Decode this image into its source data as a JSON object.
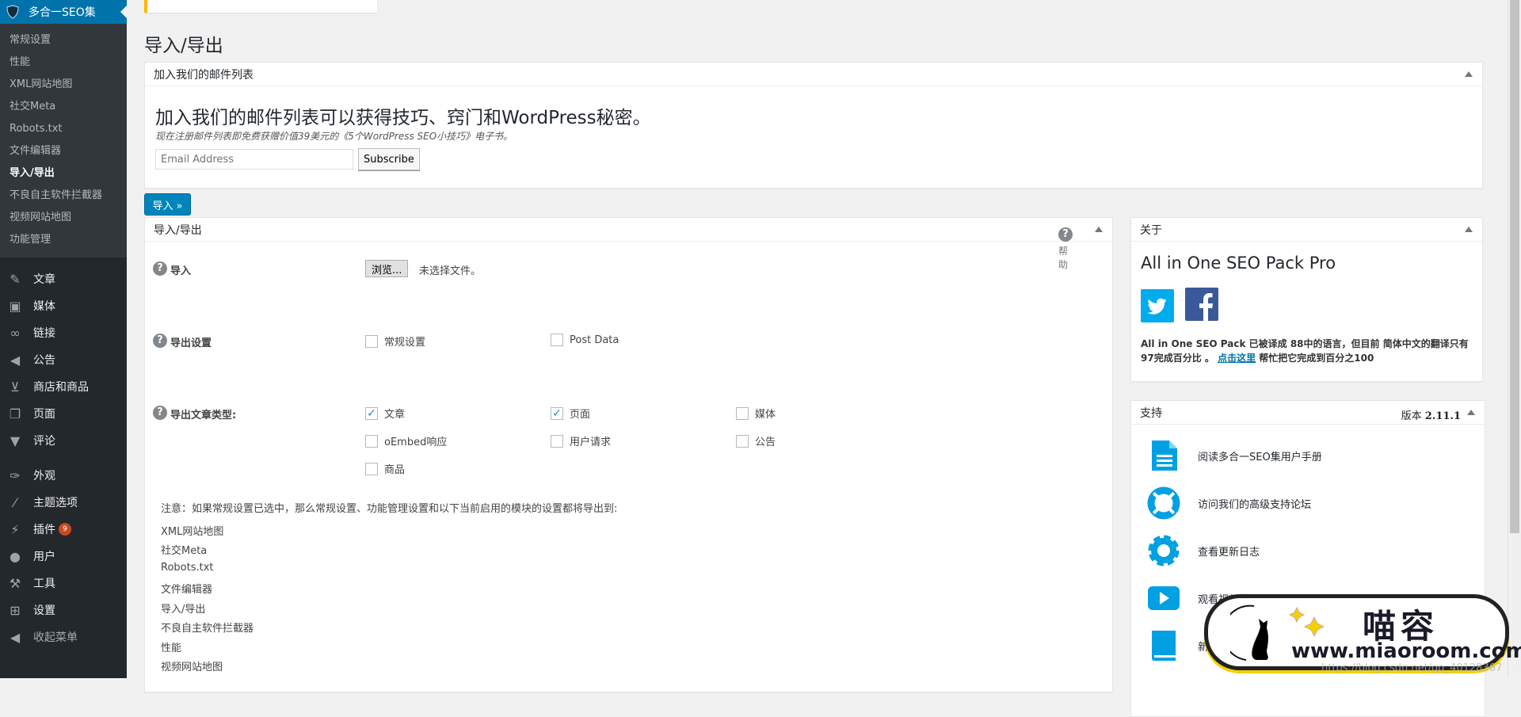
{
  "sidebar": {
    "plugin_title": "多合一SEO集",
    "submenu": [
      "常规设置",
      "性能",
      "XML网站地图",
      "社交Meta",
      "Robots.txt",
      "文件编辑器",
      "导入/导出",
      "不良自主软件拦截器",
      "视频网站地图",
      "功能管理"
    ],
    "current": "导入/导出",
    "menu": [
      {
        "label": "文章",
        "icon": "pin-icon"
      },
      {
        "label": "媒体",
        "icon": "media-icon"
      },
      {
        "label": "链接",
        "icon": "link-icon"
      },
      {
        "label": "公告",
        "icon": "megaphone-icon"
      },
      {
        "label": "商店和商品",
        "icon": "cart-icon"
      },
      {
        "label": "页面",
        "icon": "pages-icon"
      },
      {
        "label": "评论",
        "icon": "comment-icon"
      },
      {
        "label": "外观",
        "icon": "brush-icon"
      },
      {
        "label": "主题选项",
        "icon": "paintbrush-icon"
      },
      {
        "label": "插件",
        "icon": "plugin-icon",
        "badge": "9"
      },
      {
        "label": "用户",
        "icon": "user-icon"
      },
      {
        "label": "工具",
        "icon": "wrench-icon"
      },
      {
        "label": "设置",
        "icon": "settings-icon"
      }
    ],
    "collapse": "收起菜单"
  },
  "page_title": "导入/导出",
  "mailing": {
    "header": "加入我们的邮件列表",
    "headline": "加入我们的邮件列表可以获得技巧、窍门和WordPress秘密。",
    "subline": "现在注册邮件列表即免费获赠价值39美元的《5个WordPress SEO小技巧》电子书。",
    "email_placeholder": "Email Address",
    "subscribe": "Subscribe"
  },
  "import_button": "导入 »",
  "import_export": {
    "header": "导入/导出",
    "help": "帮助",
    "import_label": "导入",
    "browse": "浏览...",
    "no_file": "未选择文件。",
    "export_settings_label": "导出设置",
    "export_settings": [
      {
        "label": "常规设置",
        "checked": false
      },
      {
        "label": "Post Data",
        "checked": false
      }
    ],
    "export_types_label": "导出文章类型:",
    "export_types": [
      {
        "label": "文章",
        "checked": true
      },
      {
        "label": "页面",
        "checked": true
      },
      {
        "label": "媒体",
        "checked": false
      },
      {
        "label": "oEmbed响应",
        "checked": false
      },
      {
        "label": "用户请求",
        "checked": false
      },
      {
        "label": "公告",
        "checked": false
      },
      {
        "label": "商品",
        "checked": false
      }
    ],
    "note": "注意：如果常规设置已选中，那么常规设置、功能管理设置和以下当前启用的模块的设置都将导出到:",
    "modules": [
      "XML网站地图",
      "社交Meta",
      "Robots.txt",
      "文件编辑器",
      "导入/导出",
      "不良自主软件拦截器",
      "性能",
      "视频网站地图"
    ]
  },
  "about": {
    "header": "关于",
    "title": "All in One SEO Pack Pro",
    "desc_before": "All in One SEO Pack 已被译成 88中的语言，但目前 简体中文的翻译只有 97完成百分比 。 ",
    "link": "点击这里",
    "desc_after": " 帮忙把它完成到百分之100"
  },
  "support": {
    "header": "支持",
    "version_label": "版本",
    "version": "2.11.1",
    "items": [
      {
        "label": "阅读多合一SEO集用户手册",
        "icon": "document-icon"
      },
      {
        "label": "访问我们的高级支持论坛",
        "icon": "lifebuoy-icon"
      },
      {
        "label": "查看更新日志",
        "icon": "gear-icon"
      },
      {
        "label": "观看视频教程",
        "icon": "play-icon"
      },
      {
        "label": "新手入门",
        "icon": "book-icon"
      }
    ]
  },
  "watermark": {
    "name": "喵容",
    "url": "www.miaoroom.com",
    "csdn": "https://blog.csdn.net/qq_40128367"
  },
  "colors": {
    "accent": "#0073aa",
    "sidebar": "#23282d",
    "button": "#0085ba",
    "support_icons": "#00a0e3"
  }
}
